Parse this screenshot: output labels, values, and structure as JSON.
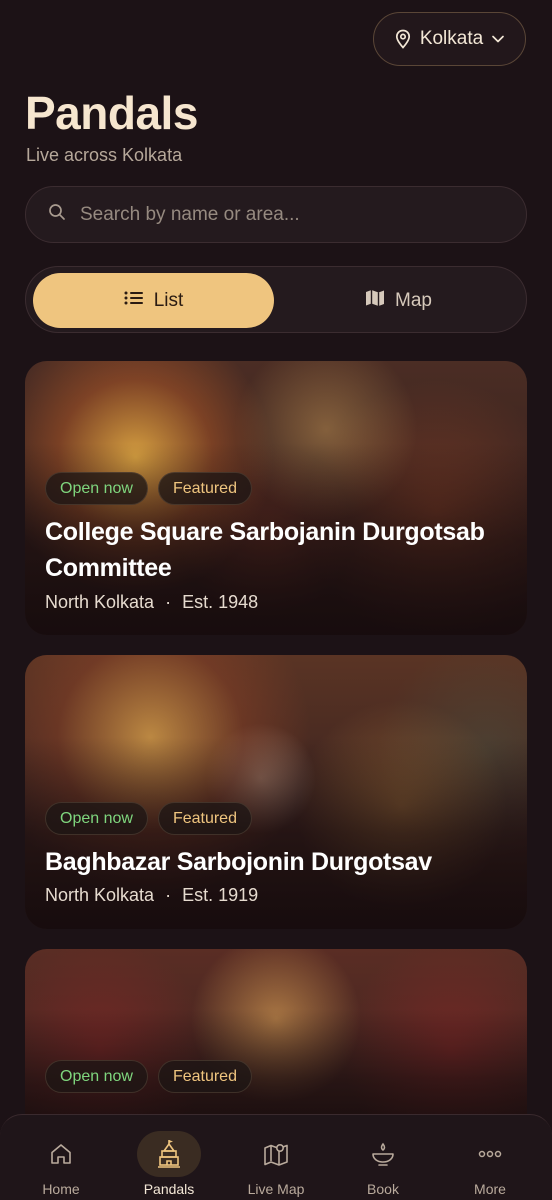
{
  "header": {
    "city": "Kolkata",
    "title": "Pandals",
    "subtitle": "Live across Kolkata"
  },
  "search": {
    "placeholder": "Search by name or area..."
  },
  "view_toggle": {
    "list_label": "List",
    "map_label": "Map",
    "selected": "List"
  },
  "cards": [
    {
      "open_badge": "Open now",
      "featured_badge": "Featured",
      "name": "College Square Sarbojanin Durgotsab Committee",
      "area": "North Kolkata",
      "separator": "·",
      "established": "Est. 1948"
    },
    {
      "open_badge": "Open now",
      "featured_badge": "Featured",
      "name": "Baghbazar Sarbojonin Durgotsav",
      "area": "North Kolkata",
      "separator": "·",
      "established": "Est. 1919"
    },
    {
      "open_badge": "Open now",
      "featured_badge": "Featured"
    }
  ],
  "tabbar": {
    "items": [
      {
        "label": "Home",
        "icon": "home-icon"
      },
      {
        "label": "Pandals",
        "icon": "temple-icon"
      },
      {
        "label": "Live Map",
        "icon": "map-pin-icon"
      },
      {
        "label": "Book",
        "icon": "diya-icon"
      },
      {
        "label": "More",
        "icon": "more-dots-icon"
      }
    ],
    "active": "Pandals"
  },
  "colors": {
    "background": "#1c1216",
    "accent": "#efc57f",
    "open_green": "#7fd67e",
    "text": "#f3e7d6"
  }
}
